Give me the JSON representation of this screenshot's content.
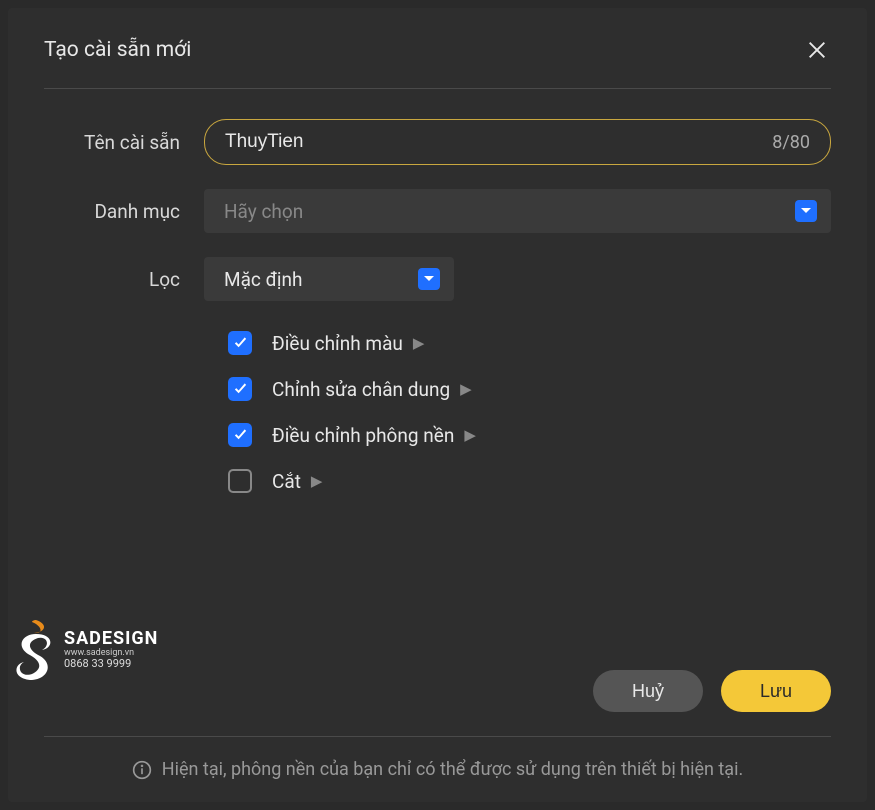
{
  "dialog": {
    "title": "Tạo cài sẵn mới"
  },
  "form": {
    "name_label": "Tên cài sẵn",
    "name_value": "ThuyTien",
    "name_count": "8/80",
    "category_label": "Danh mục",
    "category_placeholder": "Hãy chọn",
    "filter_label": "Lọc",
    "filter_value": "Mặc định"
  },
  "options": {
    "color_adjust": "Điều chỉnh màu",
    "portrait_edit": "Chỉnh sửa chân dung",
    "background_adjust": "Điều chỉnh phông nền",
    "crop": "Cắt"
  },
  "buttons": {
    "cancel": "Huỷ",
    "save": "Lưu"
  },
  "notice": "Hiện tại, phông nền của bạn chỉ có thể được sử dụng trên thiết bị hiện tại.",
  "watermark": {
    "brand": "SADESIGN",
    "site": "www.sadesign.vn",
    "phone": "0868 33 9999"
  }
}
